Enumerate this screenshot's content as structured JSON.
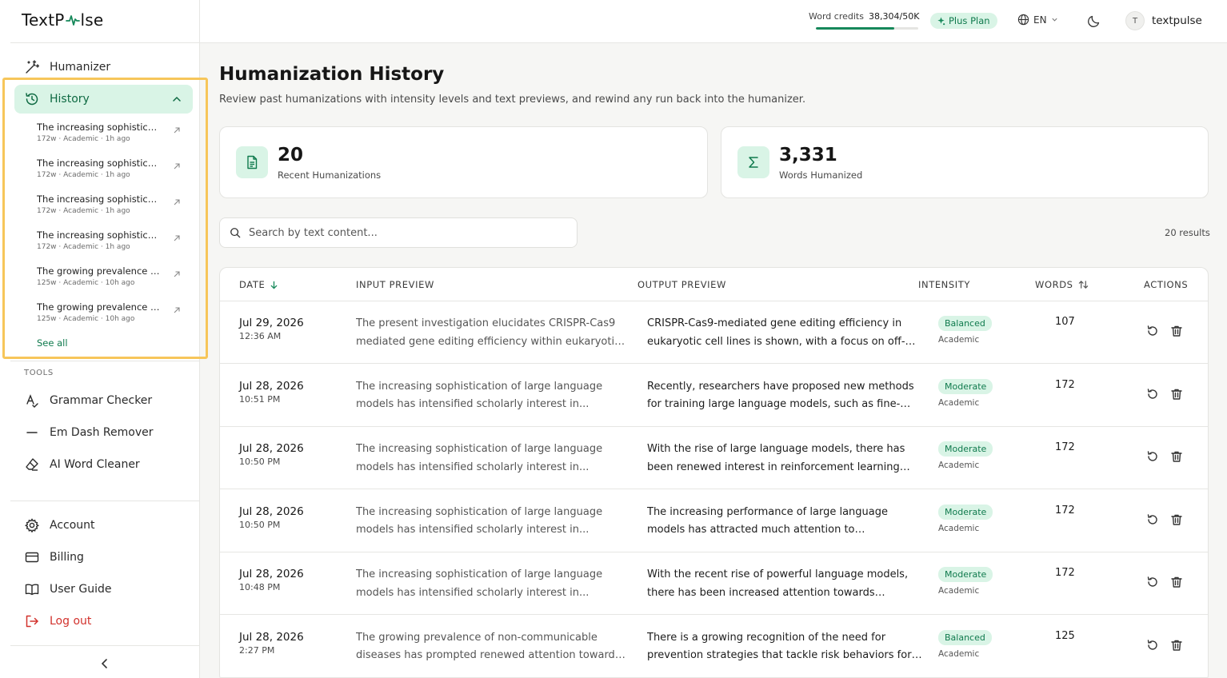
{
  "brand": {
    "left": "TextP",
    "right": "lse"
  },
  "sidebar": {
    "nav": [
      {
        "label": "Humanizer",
        "icon": "magic-wand-icon"
      },
      {
        "label": "History",
        "icon": "history-icon"
      }
    ],
    "history_items": [
      {
        "title": "The increasing sophistication of large language models",
        "meta": "172w · Academic · 1h ago"
      },
      {
        "title": "The increasing sophistication of large language models",
        "meta": "172w · Academic · 1h ago"
      },
      {
        "title": "The increasing sophistication of large language models",
        "meta": "172w · Academic · 1h ago"
      },
      {
        "title": "The increasing sophistication of large language models",
        "meta": "172w · Academic · 1h ago"
      },
      {
        "title": "The growing prevalence of non-communicable diseases",
        "meta": "125w · Academic · 10h ago"
      },
      {
        "title": "The growing prevalence of non-communicable diseases",
        "meta": "125w · Academic · 10h ago"
      }
    ],
    "see_all": "See all",
    "tools_label": "TOOLS",
    "tools": [
      {
        "label": "Grammar Checker",
        "icon": "grammar-icon"
      },
      {
        "label": "Em Dash Remover",
        "icon": "dash-icon"
      },
      {
        "label": "AI Word Cleaner",
        "icon": "eraser-icon"
      }
    ],
    "account": [
      {
        "label": "Account",
        "icon": "gear-icon"
      },
      {
        "label": "Billing",
        "icon": "credit-card-icon"
      },
      {
        "label": "User Guide",
        "icon": "book-icon"
      },
      {
        "label": "Log out",
        "icon": "logout-icon"
      }
    ]
  },
  "topbar": {
    "credits_label": "Word credits",
    "credits_value": "38,304/50K",
    "credits_fraction": 0.766,
    "plan": "Plus Plan",
    "language": "EN",
    "avatar_initial": "T",
    "username": "textpulse"
  },
  "main": {
    "title": "Humanization History",
    "subtitle": "Review past humanizations with intensity levels and text previews, and rewind any run back into the humanizer.",
    "stats": [
      {
        "value": "20",
        "label": "Recent Humanizations",
        "icon": "document-icon"
      },
      {
        "value": "3,331",
        "label": "Words Humanized",
        "icon": "sigma-icon"
      }
    ],
    "search_placeholder": "Search by text content...",
    "results": "20 results",
    "columns": {
      "date": "DATE",
      "input": "INPUT PREVIEW",
      "output": "OUTPUT PREVIEW",
      "intensity": "INTENSITY",
      "words": "WORDS",
      "actions": "ACTIONS"
    },
    "rows": [
      {
        "date": "Jul 29, 2026",
        "time": "12:36 AM",
        "input": "The present investigation elucidates CRISPR-Cas9 mediated gene editing efficiency within eukaryotic cell lines",
        "output": "CRISPR-Cas9-mediated gene editing efficiency in eukaryotic cell lines is shown, with a focus on off-target effects",
        "intensity": "Balanced",
        "category": "Academic",
        "words": "107"
      },
      {
        "date": "Jul 28, 2026",
        "time": "10:51 PM",
        "input": "The increasing sophistication of large language models has intensified scholarly interest in...",
        "output": "Recently, researchers have proposed new methods for training large language models, such as fine-tuning",
        "intensity": "Moderate",
        "category": "Academic",
        "words": "172"
      },
      {
        "date": "Jul 28, 2026",
        "time": "10:50 PM",
        "input": "The increasing sophistication of large language models has intensified scholarly interest in...",
        "output": "With the rise of large language models, there has been renewed interest in reinforcement learning from feedback",
        "intensity": "Moderate",
        "category": "Academic",
        "words": "172"
      },
      {
        "date": "Jul 28, 2026",
        "time": "10:50 PM",
        "input": "The increasing sophistication of large language models has intensified scholarly interest in...",
        "output": "The increasing performance of large language models has attracted much attention to reinforcement learning",
        "intensity": "Moderate",
        "category": "Academic",
        "words": "172"
      },
      {
        "date": "Jul 28, 2026",
        "time": "10:48 PM",
        "input": "The increasing sophistication of large language models has intensified scholarly interest in...",
        "output": "With the recent rise of powerful language models, there has been increased attention towards alignment",
        "intensity": "Moderate",
        "category": "Academic",
        "words": "172"
      },
      {
        "date": "Jul 28, 2026",
        "time": "2:27 PM",
        "input": "The growing prevalence of non-communicable diseases has prompted renewed attention towards prevention",
        "output": "There is a growing recognition of the need for prevention strategies that tackle risk behaviors for chronic disease",
        "intensity": "Balanced",
        "category": "Academic",
        "words": "125"
      }
    ]
  }
}
